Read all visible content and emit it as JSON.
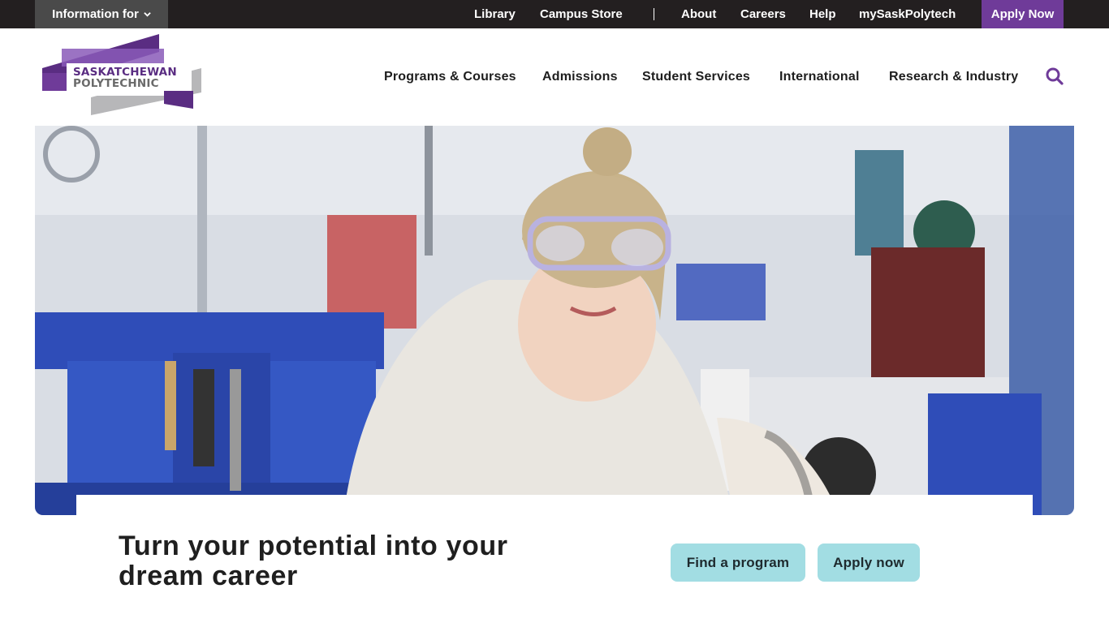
{
  "utility_bar": {
    "info_for_label": "Information for",
    "links": [
      "Library",
      "Campus Store",
      "About",
      "Careers",
      "Help",
      "mySaskPolytech"
    ],
    "apply_label": "Apply Now"
  },
  "logo": {
    "line1": "SASKATCHEWAN",
    "line2": "POLYTECHNIC"
  },
  "nav": {
    "items": [
      "Programs & Courses",
      "Admissions",
      "Student Services",
      "International",
      "Research & Industry"
    ]
  },
  "hero": {
    "headline": "Turn your potential into your dream career",
    "cta_find": "Find a program",
    "cta_apply": "Apply now"
  },
  "colors": {
    "brand_purple": "#6f3b99",
    "utility_bg": "#231f20",
    "cta_bg": "#a2dde3"
  },
  "icons": {
    "dropdown": "chevron-down-icon",
    "search": "search-icon"
  }
}
